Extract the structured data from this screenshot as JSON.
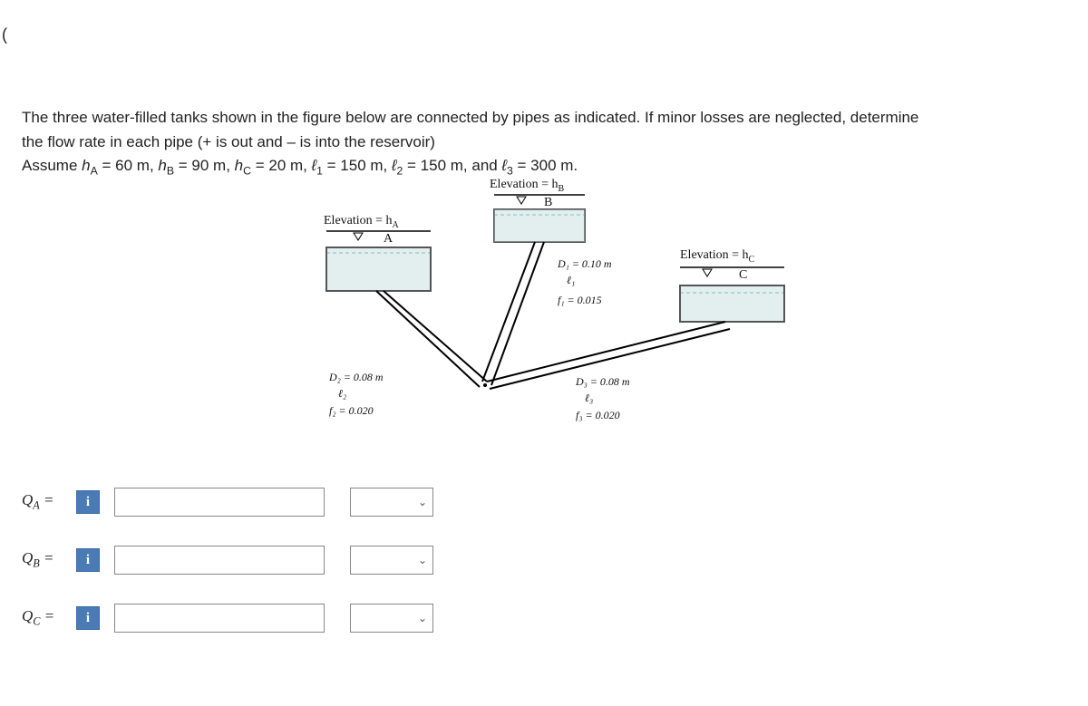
{
  "stray_paren": "(",
  "problem": {
    "line1_a": "The three water-filled tanks shown in the figure below are connected by pipes as indicated. If minor losses are neglected, determine",
    "line2_a": "the flow rate in each pipe (+ is out and – is into the reservoir)",
    "line3_prefix": "Assume ",
    "hA_lbl": "h",
    "hA_sub": "A",
    "hA_eq": " = 60 m, ",
    "hB_lbl": "h",
    "hB_sub": "B",
    "hB_eq": " = 90 m, ",
    "hC_lbl": "h",
    "hC_sub": "C",
    "hC_eq": " = 20 m, ",
    "l1_lbl": "ℓ",
    "l1_sub": "1",
    "l1_eq": "  =   150 m, ",
    "l2_lbl": "ℓ",
    "l2_sub": "2",
    "l2_eq": "  =   150 m, and ",
    "l3_lbl": "ℓ",
    "l3_sub": "3",
    "l3_eq": "  =   300 m."
  },
  "figure": {
    "elevA": "Elevation = h",
    "elevA_sub": "A",
    "elevB": "Elevation = h",
    "elevB_sub": "B",
    "elevC": "Elevation = h",
    "elevC_sub": "C",
    "tankA": "A",
    "tankB": "B",
    "tankC": "C",
    "pipe1_D": "D₁ = 0.10 m",
    "pipe1_l": "ℓ₁",
    "pipe1_f": "f₁ = 0.015",
    "pipe2_D": "D₂ = 0.08 m",
    "pipe2_l": "ℓ₂",
    "pipe2_f": "f₂ = 0.020",
    "pipe3_D": "D₃ = 0.08 m",
    "pipe3_l": "ℓ₃",
    "pipe3_f": "f₃ = 0.020"
  },
  "answers": {
    "QA_lbl": "Q",
    "QA_sub": "A",
    "QB_lbl": "Q",
    "QB_sub": "B",
    "QC_lbl": "Q",
    "QC_sub": "C",
    "eq": " =",
    "info": "i"
  }
}
